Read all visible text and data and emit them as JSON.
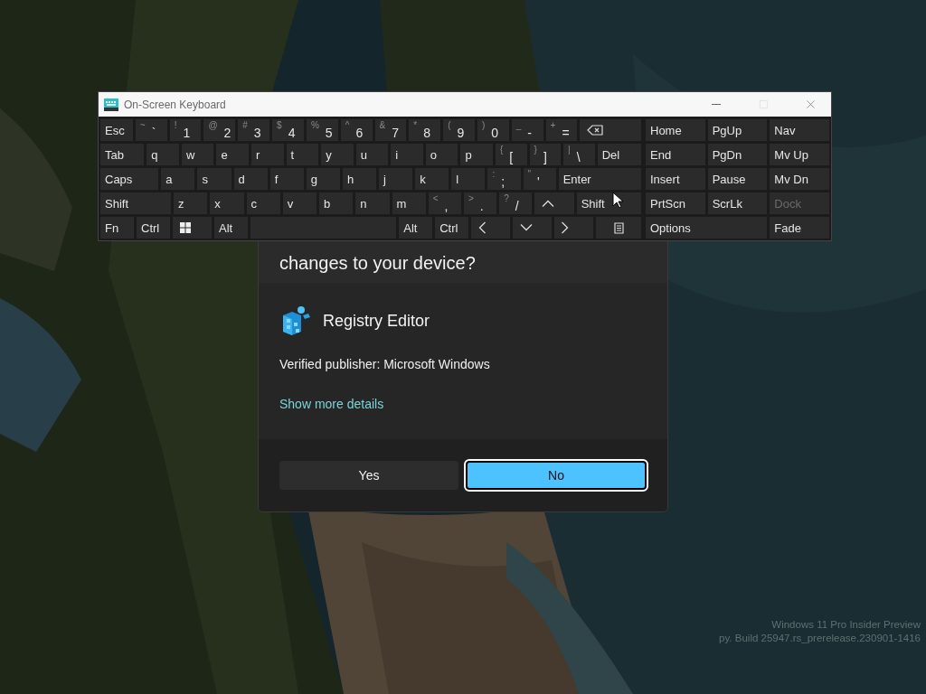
{
  "keyboard_window": {
    "title": "On-Screen Keyboard",
    "main_rows": [
      [
        {
          "kind": "key",
          "label": "Esc"
        },
        {
          "kind": "key",
          "shift": "~",
          "label": "`"
        },
        {
          "kind": "key",
          "shift": "!",
          "label": "1"
        },
        {
          "kind": "key",
          "shift": "@",
          "label": "2"
        },
        {
          "kind": "key",
          "shift": "#",
          "label": "3"
        },
        {
          "kind": "key",
          "shift": "$",
          "label": "4"
        },
        {
          "kind": "key",
          "shift": "%",
          "label": "5"
        },
        {
          "kind": "key",
          "shift": "^",
          "label": "6"
        },
        {
          "kind": "key",
          "shift": "&",
          "label": "7"
        },
        {
          "kind": "key",
          "shift": "*",
          "label": "8"
        },
        {
          "kind": "key",
          "shift": "(",
          "label": "9"
        },
        {
          "kind": "key",
          "shift": ")",
          "label": "0"
        },
        {
          "kind": "key",
          "shift": "_",
          "label": "-"
        },
        {
          "kind": "key",
          "shift": "+",
          "label": "="
        },
        {
          "kind": "backspace"
        }
      ],
      [
        {
          "kind": "key",
          "label": "Tab"
        },
        {
          "kind": "key",
          "label": "q"
        },
        {
          "kind": "key",
          "label": "w"
        },
        {
          "kind": "key",
          "label": "e"
        },
        {
          "kind": "key",
          "label": "r"
        },
        {
          "kind": "key",
          "label": "t"
        },
        {
          "kind": "key",
          "label": "y"
        },
        {
          "kind": "key",
          "label": "u"
        },
        {
          "kind": "key",
          "label": "i"
        },
        {
          "kind": "key",
          "label": "o"
        },
        {
          "kind": "key",
          "label": "p"
        },
        {
          "kind": "key",
          "shift": "{",
          "label": "["
        },
        {
          "kind": "key",
          "shift": "}",
          "label": "]"
        },
        {
          "kind": "key",
          "shift": "|",
          "label": "\\"
        },
        {
          "kind": "key",
          "label": "Del"
        }
      ],
      [
        {
          "kind": "key",
          "label": "Caps"
        },
        {
          "kind": "key",
          "label": "a"
        },
        {
          "kind": "key",
          "label": "s"
        },
        {
          "kind": "key",
          "label": "d"
        },
        {
          "kind": "key",
          "label": "f"
        },
        {
          "kind": "key",
          "label": "g"
        },
        {
          "kind": "key",
          "label": "h"
        },
        {
          "kind": "key",
          "label": "j"
        },
        {
          "kind": "key",
          "label": "k"
        },
        {
          "kind": "key",
          "label": "l"
        },
        {
          "kind": "key",
          "shift": ":",
          "label": ";"
        },
        {
          "kind": "key",
          "shift": "\"",
          "label": "'"
        },
        {
          "kind": "key",
          "label": "Enter"
        }
      ],
      [
        {
          "kind": "key",
          "label": "Shift"
        },
        {
          "kind": "key",
          "label": "z"
        },
        {
          "kind": "key",
          "label": "x"
        },
        {
          "kind": "key",
          "label": "c"
        },
        {
          "kind": "key",
          "label": "v"
        },
        {
          "kind": "key",
          "label": "b"
        },
        {
          "kind": "key",
          "label": "n"
        },
        {
          "kind": "key",
          "label": "m"
        },
        {
          "kind": "key",
          "shift": "<",
          "label": ","
        },
        {
          "kind": "key",
          "shift": ">",
          "label": "."
        },
        {
          "kind": "key",
          "shift": "?",
          "label": "/"
        },
        {
          "kind": "up"
        },
        {
          "kind": "key",
          "label": "Shift"
        }
      ],
      [
        {
          "kind": "key",
          "label": "Fn"
        },
        {
          "kind": "key",
          "label": "Ctrl"
        },
        {
          "kind": "windows"
        },
        {
          "kind": "key",
          "label": "Alt"
        },
        {
          "kind": "space"
        },
        {
          "kind": "key",
          "label": "Alt"
        },
        {
          "kind": "key",
          "label": "Ctrl"
        },
        {
          "kind": "left"
        },
        {
          "kind": "down"
        },
        {
          "kind": "right"
        },
        {
          "kind": "menu"
        }
      ]
    ],
    "side_rows": [
      [
        {
          "label": "Home",
          "disabled": false
        },
        {
          "label": "PgUp",
          "disabled": false
        },
        {
          "label": "Nav",
          "disabled": false
        }
      ],
      [
        {
          "label": "End",
          "disabled": false
        },
        {
          "label": "PgDn",
          "disabled": false
        },
        {
          "label": "Mv Up",
          "disabled": false
        }
      ],
      [
        {
          "label": "Insert",
          "disabled": false
        },
        {
          "label": "Pause",
          "disabled": false
        },
        {
          "label": "Mv Dn",
          "disabled": false
        }
      ],
      [
        {
          "label": "PrtScn",
          "disabled": false
        },
        {
          "label": "ScrLk",
          "disabled": false
        },
        {
          "label": "Dock",
          "disabled": true
        }
      ],
      [
        {
          "label": "Options",
          "disabled": false
        },
        {
          "label": "Fade",
          "disabled": false
        }
      ]
    ]
  },
  "uac_dialog": {
    "heading_lines": [
      "changes to your device?"
    ],
    "app_name": "Registry Editor",
    "publisher": "Verified publisher: Microsoft Windows",
    "details_link": "Show more details",
    "buttons": [
      {
        "label": "Yes",
        "focused": false,
        "primary": false
      },
      {
        "label": "No",
        "focused": true,
        "primary": true
      }
    ]
  },
  "desktop_watermark": [
    "Windows 11 Pro Insider Preview",
    "py. Build 25947.rs_prerelease.230901-1416"
  ]
}
